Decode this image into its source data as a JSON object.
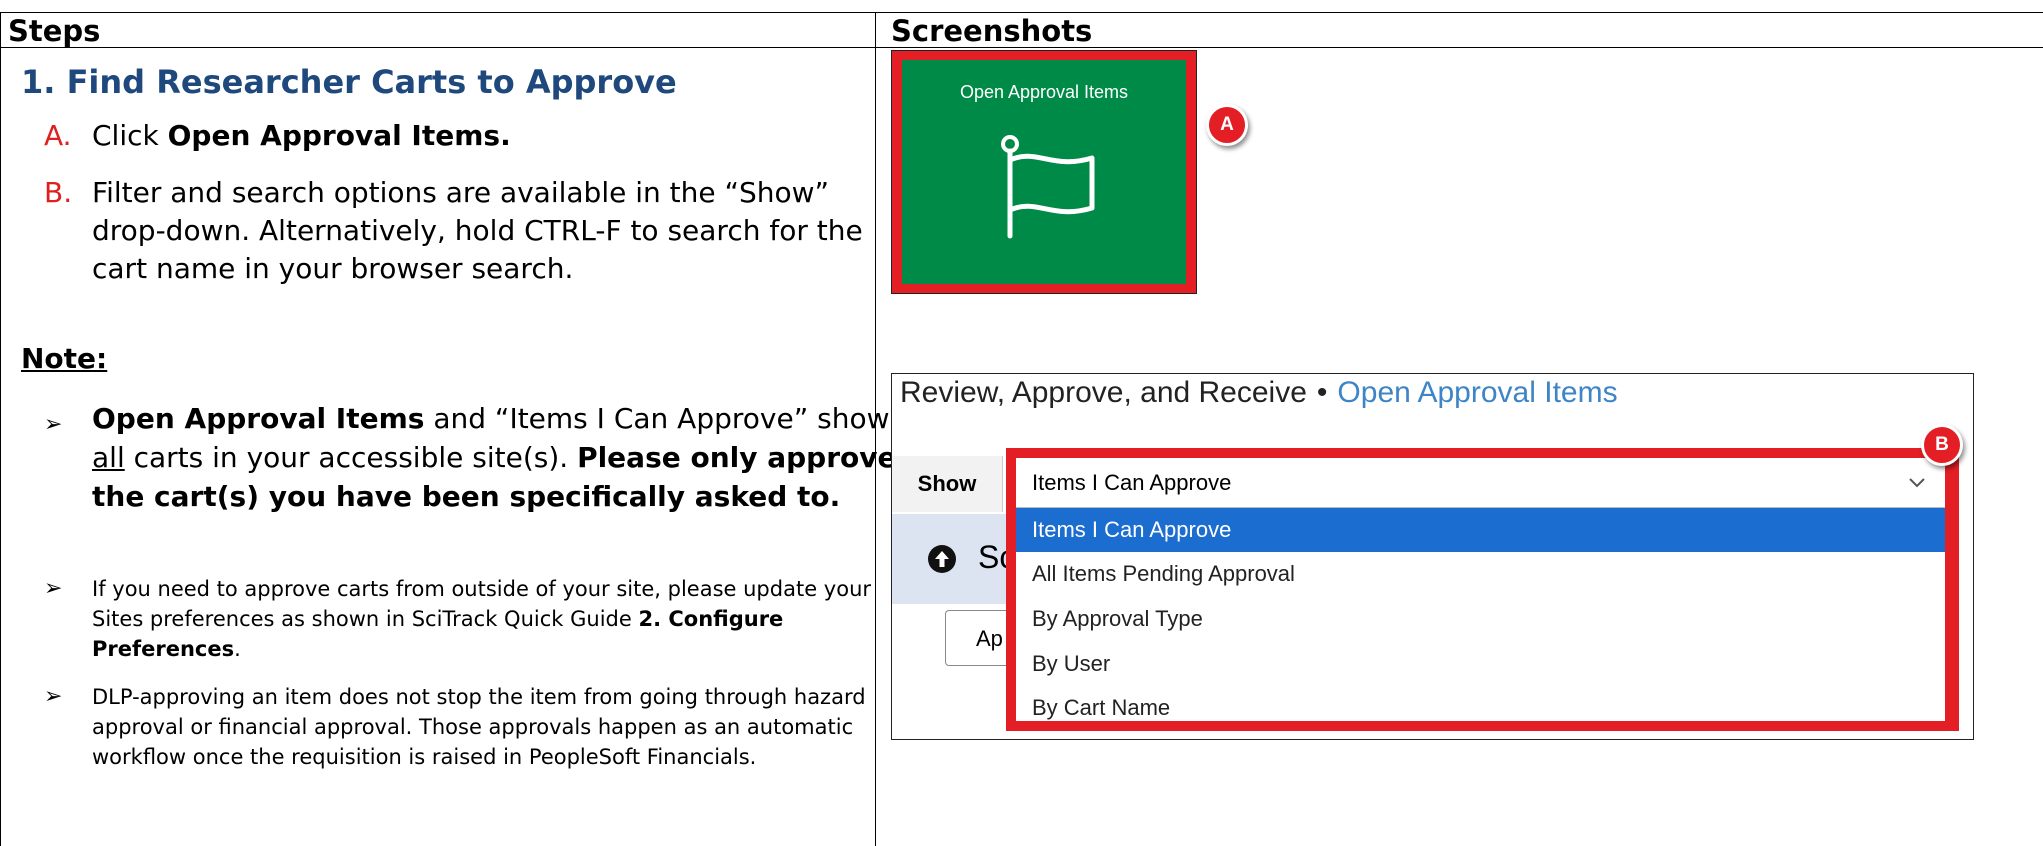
{
  "headers": {
    "steps": "Steps",
    "screenshots": "Screenshots"
  },
  "section_title": "1. Find Researcher Carts to Approve",
  "steps": [
    {
      "letter": "A.",
      "pre": "Click ",
      "bold": "Open Approval Items.",
      "post": ""
    },
    {
      "letter": "B.",
      "text": "Filter and search options are available in the “Show” drop-down. Alternatively, hold CTRL-F to search for the cart name in your browser search."
    }
  ],
  "note_heading": "Note:",
  "notes": [
    {
      "arrow": "➢",
      "bold1": "Open Approval Items",
      "t1": " and “Items I Can Approve” shows ",
      "underline": "all",
      "t2": " carts in your accessible site(s). ",
      "bold2": "Please only approve the cart(s) you have been specifically asked to."
    },
    {
      "arrow": "➢",
      "t1": "If you need to approve carts from outside of your site, please update your Sites preferences as shown in SciTrack Quick Guide ",
      "bold": "2. Configure Preferences",
      "t2": "."
    },
    {
      "arrow": "➢",
      "text": "DLP-approving an item does not stop the item from going through hazard approval or financial approval. Those approvals happen as an automatic workflow once the requisition is raised in PeopleSoft Financials."
    }
  ],
  "screenshot_a": {
    "tile_label": "Open Approval Items",
    "icon": "flag-icon",
    "badge": "A"
  },
  "screenshot_b": {
    "breadcrumb_root": "Review, Approve, and Receive",
    "breadcrumb_sep": "•",
    "breadcrumb_current": "Open Approval Items",
    "show_label": "Show",
    "selected_value": "Items I Can Approve",
    "options": [
      "Items I Can Approve",
      "All Items Pending Approval",
      "By Approval Type",
      "By User",
      "By Cart Name"
    ],
    "panel_text": "Sc",
    "button_stub": "Ap",
    "badge": "B"
  },
  "colors": {
    "title": "#1f497d",
    "letter": "#e02020",
    "tile": "#008a47",
    "highlight": "#e31e24",
    "link": "#3d85c6",
    "selected": "#1c6dd0"
  }
}
